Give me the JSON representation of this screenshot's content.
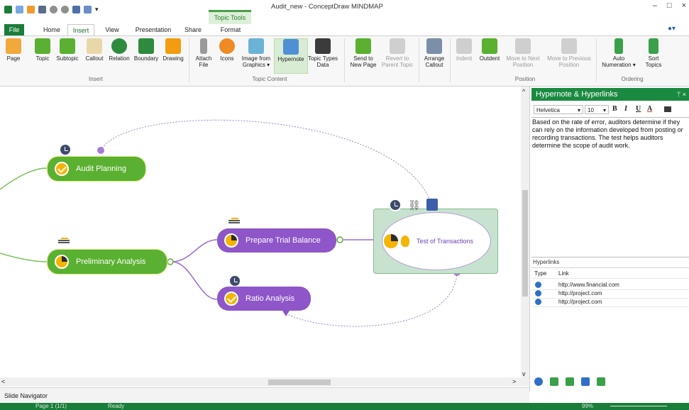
{
  "window": {
    "title": "Audit_new - ConceptDraw MINDMAP",
    "contextual_tab": "Topic Tools",
    "controls": [
      "–",
      "□",
      "×"
    ]
  },
  "tabs": [
    "File",
    "Home",
    "Insert",
    "View",
    "Presentation",
    "Share",
    "Format"
  ],
  "ribbon": {
    "insert_group": {
      "label": "Insert",
      "buttons": [
        "Page",
        "Topic",
        "Subtopic",
        "Callout",
        "Relation",
        "Boundary",
        "Drawing"
      ]
    },
    "content_group": {
      "label": "Topic Content",
      "buttons": [
        "Attach File",
        "Icons",
        "Image from Graphics",
        "Hypernote",
        "Topic Types Data"
      ]
    },
    "position_group": {
      "label": "Position",
      "buttons": [
        "Send to New Page",
        "Revert to Parent Topic",
        "Arrange Callout",
        "Indent",
        "Outdent",
        "Move to Next Position",
        "Move to Previous Position"
      ]
    },
    "ordering_group": {
      "label": "Ordering",
      "buttons": [
        "Auto Numeration",
        "Sort Topics"
      ]
    }
  },
  "mindmap": {
    "audit_planning": "Audit Planning",
    "preliminary_analysis": "Preliminary Analysis",
    "prepare_trial_balance": "Prepare Trial Balance",
    "ratio_analysis": "Ratio Analysis",
    "test_of_transactions": "Test of Transactions"
  },
  "panel": {
    "title": "Hypernote & Hyperlinks",
    "pin": "ᛘ ×",
    "font": "Helvetica",
    "size": "10",
    "note": "Based on the rate of error, auditors determine if they can rely on the information developed from posting or recording transactions. The test helps auditors determine the scope of audit work.",
    "hyperlinks_label": "Hyperlinks",
    "columns": [
      "Type",
      "Link"
    ],
    "links": [
      "http://www.financial.com",
      "http://project.com",
      "http://project.com"
    ]
  },
  "slide_navigator": "Slide Navigator",
  "status": {
    "page": "Page 1 (1/1)",
    "state": "Ready",
    "zoom": "99%"
  },
  "colors": {
    "green_accent": "#1b7d3a",
    "topic_green": "#5ab030",
    "topic_purple": "#8e56c8",
    "central_fill": "#c7e3cf"
  }
}
